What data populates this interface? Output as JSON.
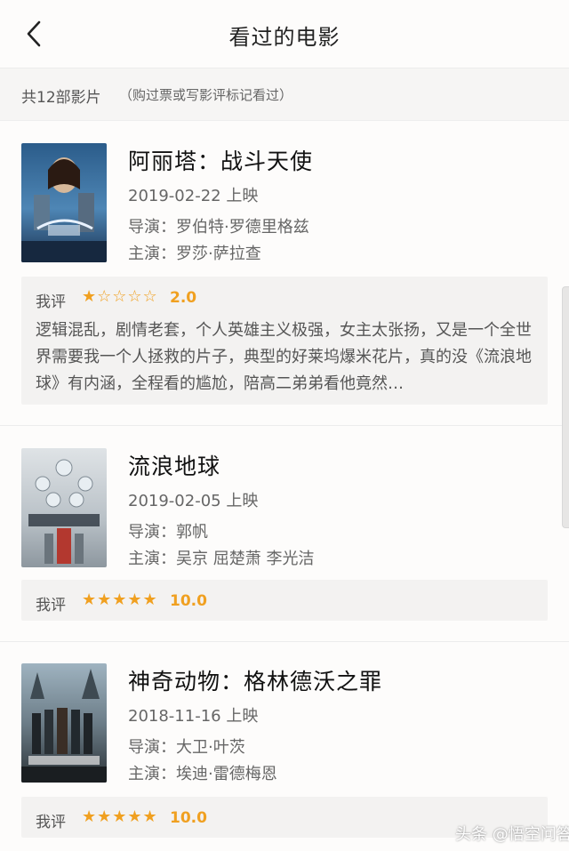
{
  "header": {
    "title": "看过的电影",
    "back_icon": "chevron-left-icon"
  },
  "summary": {
    "count": "共12部影片",
    "note": "（购过票或写影评标记看过）"
  },
  "movies": [
    {
      "title": "阿丽塔：战斗天使",
      "date": "2019-02-22 上映",
      "director": "导演：罗伯特·罗德里格兹",
      "cast": "主演：罗莎·萨拉查",
      "review_label": "我评",
      "rating": 2.0,
      "stars": "★☆☆☆☆",
      "score": "2.0",
      "review_text": "逻辑混乱，剧情老套，个人英雄主义极强，女主太张扬，又是一个全世界需要我一个人拯救的片子，典型的好莱坞爆米花片，真的没《流浪地球》有内涵，全程看的尴尬，陪高二弟弟看他竟然…"
    },
    {
      "title": "流浪地球",
      "date": "2019-02-05 上映",
      "director": "导演：郭帆",
      "cast": "主演：吴京 屈楚萧 李光洁",
      "review_label": "我评",
      "rating": 10.0,
      "stars": "★★★★★",
      "score": "10.0",
      "review_text": ""
    },
    {
      "title": "神奇动物：格林德沃之罪",
      "date": "2018-11-16 上映",
      "director": "导演：大卫·叶茨",
      "cast": "主演：埃迪·雷德梅恩",
      "review_label": "我评",
      "rating": 10.0,
      "stars": "★★★★★",
      "score": "10.0",
      "review_text": ""
    }
  ],
  "watermark": "头条 @悟空问答",
  "colors": {
    "accent": "#f0a020",
    "background": "#fdfcfb",
    "review_bg": "#f3f2f1"
  }
}
